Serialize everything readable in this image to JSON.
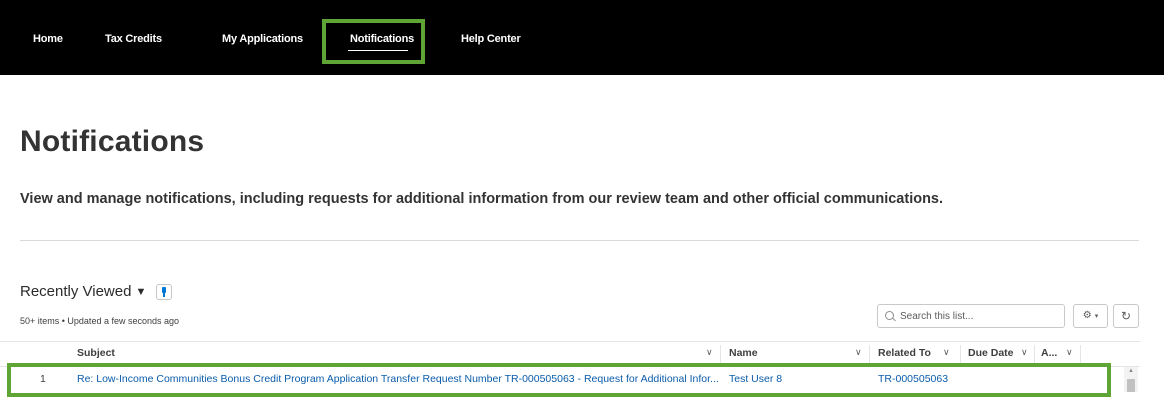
{
  "nav": {
    "items": [
      {
        "label": "Home"
      },
      {
        "label": "Tax Credits"
      },
      {
        "label": "My Applications"
      },
      {
        "label": "Notifications"
      },
      {
        "label": "Help Center"
      }
    ],
    "active": "Notifications",
    "highlight_color": "#5ea536"
  },
  "header": {
    "title": "Notifications",
    "description": "View and manage notifications, including requests for additional information from our review team and other official communications."
  },
  "list_view": {
    "title": "Recently Viewed",
    "meta": "50+ items • Updated a few seconds ago",
    "search_placeholder": "Search this list...",
    "settings_icon": "gear-icon",
    "refresh_icon": "refresh-icon",
    "columns": [
      "Subject",
      "Name",
      "Related To",
      "Due Date",
      "A..."
    ],
    "rows": [
      {
        "num": "1",
        "subject": "Re: Low-Income Communities Bonus Credit Program Application Transfer Request Number TR-000505063 - Request for Additional Infor...",
        "name": "Test User 8",
        "related_to": "TR-000505063",
        "due_date": "",
        "a": ""
      }
    ]
  },
  "colors": {
    "nav_bg": "#000000",
    "link": "#0b5cab",
    "highlight": "#5ea536"
  }
}
